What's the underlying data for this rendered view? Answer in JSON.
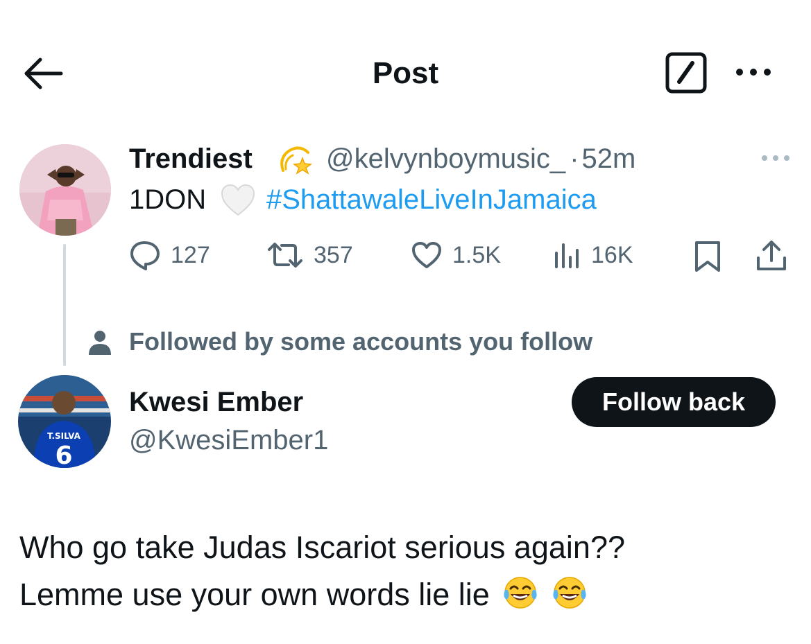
{
  "header": {
    "title": "Post"
  },
  "tweet": {
    "display_name": "Trendiest",
    "name_emoji": "dizzy-icon",
    "handle": "@kelvynboymusic_",
    "separator": "·",
    "time": "52m",
    "text_prefix": "1DON",
    "text_emoji": "white-heart-icon",
    "hashtag": "#ShattawaleLiveInJamaica",
    "stats": {
      "replies": "127",
      "reposts": "357",
      "likes": "1.5K",
      "views": "16K"
    }
  },
  "followed_by": {
    "text": "Followed by some accounts you follow"
  },
  "reply_author": {
    "display_name": "Kwesi Ember",
    "handle": "@KwesiEmber1",
    "follow_button": "Follow back",
    "jersey_name": "T.SILVA",
    "jersey_number": "6"
  },
  "reply": {
    "line1": "Who go take Judas Iscariot serious again??",
    "line2": "Lemme use your own words lie lie",
    "emojis": [
      "laughing-tears-icon",
      "laughing-tears-icon"
    ]
  },
  "colors": {
    "text": "#0f1419",
    "secondary": "#536471",
    "link": "#1d9bf0",
    "button_bg": "#0f1419",
    "thread_line": "#cfd9de"
  }
}
